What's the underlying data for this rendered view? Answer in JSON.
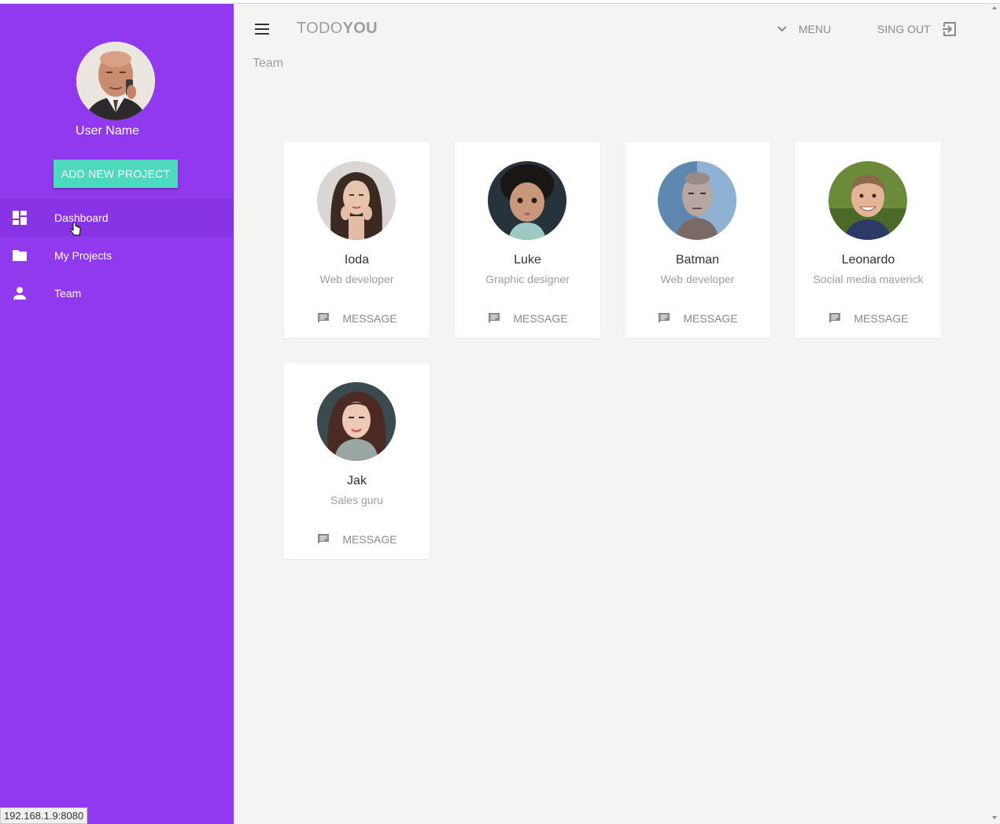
{
  "sidebar": {
    "user_name": "User Name",
    "add_button": "ADD NEW PROJECT",
    "items": [
      {
        "label": "Dashboard",
        "icon": "dashboard-icon"
      },
      {
        "label": "My Projects",
        "icon": "folder-icon"
      },
      {
        "label": "Team",
        "icon": "person-icon"
      }
    ]
  },
  "toolbar": {
    "brand_light": "TODO",
    "brand_bold": "YOU",
    "menu_label": "MENU",
    "signout_label": "SING OUT"
  },
  "page": {
    "subheading": "Team"
  },
  "team": [
    {
      "name": "Ioda",
      "role": "Web developer",
      "action": "MESSAGE"
    },
    {
      "name": "Luke",
      "role": "Graphic designer",
      "action": "MESSAGE"
    },
    {
      "name": "Batman",
      "role": "Web developer",
      "action": "MESSAGE"
    },
    {
      "name": "Leonardo",
      "role": "Social media maverick",
      "action": "MESSAGE"
    },
    {
      "name": "Jak",
      "role": "Sales guru",
      "action": "MESSAGE"
    }
  ],
  "status_bar": {
    "url": "192.168.1.9:8080"
  },
  "colors": {
    "sidebar": "#9039ef",
    "accent": "#4dd9bd",
    "background": "#f4f4f2"
  }
}
